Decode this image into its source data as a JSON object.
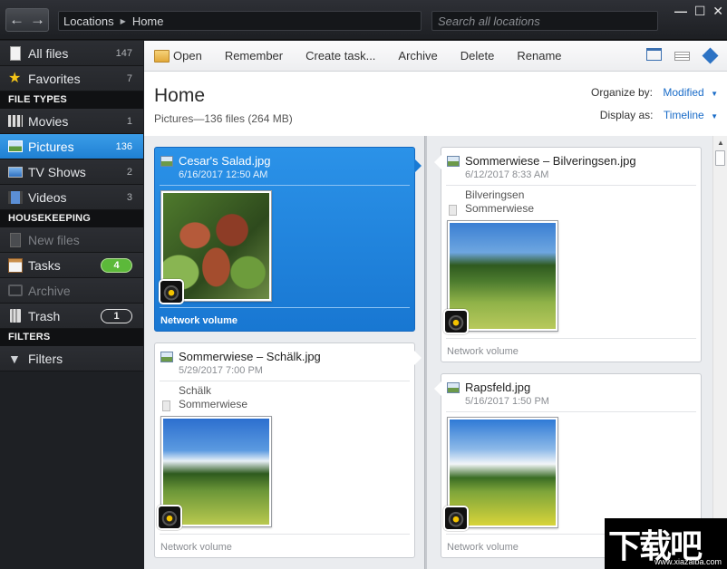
{
  "titlebar": {
    "breadcrumb": [
      "Locations",
      "Home"
    ],
    "search_placeholder": "Search all locations",
    "window_controls": [
      "minimize",
      "maximize",
      "close"
    ]
  },
  "sidebar": {
    "top_items": [
      {
        "label": "All files",
        "count": "147",
        "icon": "file-icon"
      },
      {
        "label": "Favorites",
        "count": "7",
        "icon": "star-icon"
      }
    ],
    "file_types_heading": "FILE TYPES",
    "file_types": [
      {
        "label": "Movies",
        "count": "1",
        "icon": "film-icon"
      },
      {
        "label": "Pictures",
        "count": "136",
        "icon": "picture-icon",
        "active": true
      },
      {
        "label": "TV Shows",
        "count": "2",
        "icon": "tv-icon"
      },
      {
        "label": "Videos",
        "count": "3",
        "icon": "video-icon"
      }
    ],
    "housekeeping_heading": "HOUSEKEEPING",
    "housekeeping": [
      {
        "label": "New files",
        "icon": "new-file-icon",
        "disabled": true
      },
      {
        "label": "Tasks",
        "badge": "4",
        "icon": "tasks-icon"
      },
      {
        "label": "Archive",
        "icon": "archive-icon",
        "disabled": true
      },
      {
        "label": "Trash",
        "badge": "1",
        "icon": "trash-icon"
      }
    ],
    "filters_heading": "FILTERS",
    "filters": [
      {
        "label": "Filters",
        "icon": "funnel-icon"
      }
    ]
  },
  "toolbar": {
    "open": "Open",
    "remember": "Remember",
    "create_task": "Create task...",
    "archive": "Archive",
    "delete": "Delete",
    "rename": "Rename"
  },
  "header": {
    "title": "Home",
    "subtitle": "Pictures—136 files (264 MB)",
    "organize_label": "Organize by:",
    "organize_value": "Modified",
    "display_label": "Display as:",
    "display_value": "Timeline"
  },
  "cards": [
    {
      "name": "Cesar's Salad.jpg",
      "date": "6/16/2017 12:50 AM",
      "tags": [],
      "location": "Network volume"
    },
    {
      "name": "Sommerwiese – Bilveringsen.jpg",
      "date": "6/12/2017 8:33 AM",
      "tags": [
        "Bilveringsen",
        "Sommerwiese"
      ],
      "location": "Network volume"
    },
    {
      "name": "Sommerwiese – Schälk.jpg",
      "date": "5/29/2017 7:00 PM",
      "tags": [
        "Schälk",
        "Sommerwiese"
      ],
      "location": "Network volume"
    },
    {
      "name": "Rapsfeld.jpg",
      "date": "5/16/2017 1:50 PM",
      "tags": [],
      "location": "Network volume"
    }
  ],
  "watermark": {
    "big": "下载吧",
    "small": "www.xiazaiba.com"
  },
  "colors": {
    "accent": "#1f80d3",
    "badge_green": "#5cb93a",
    "link": "#1a6cc8"
  }
}
